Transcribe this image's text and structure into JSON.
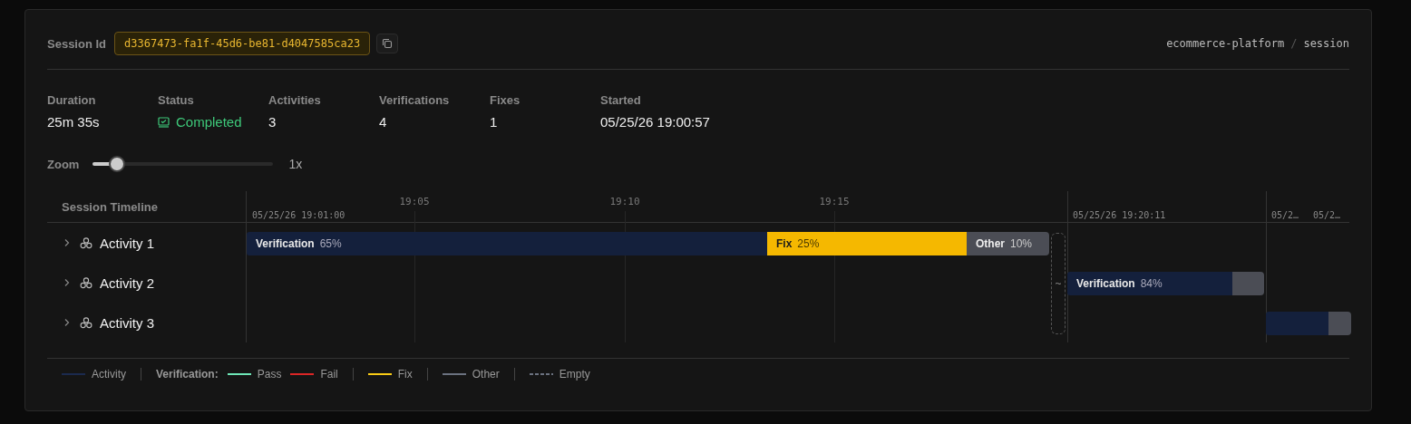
{
  "session": {
    "label": "Session Id",
    "id": "d3367473-fa1f-45d6-be81-d4047585ca23"
  },
  "breadcrumb": {
    "separator": "/",
    "items": [
      "ecommerce-platform",
      "session"
    ]
  },
  "stats": [
    {
      "label": "Duration",
      "value": "25m 35s",
      "kind": "plain"
    },
    {
      "label": "Status",
      "value": "Completed",
      "kind": "status"
    },
    {
      "label": "Activities",
      "value": "3",
      "kind": "plain"
    },
    {
      "label": "Verifications",
      "value": "4",
      "kind": "plain"
    },
    {
      "label": "Fixes",
      "value": "1",
      "kind": "plain"
    },
    {
      "label": "Started",
      "value": "05/25/26 19:00:57",
      "kind": "plain"
    }
  ],
  "zoom": {
    "label": "Zoom",
    "level": 0.135,
    "reading": "1x"
  },
  "timeline": {
    "header": "Session Timeline",
    "ticks": [
      "19:05",
      "19:10",
      "19:15"
    ],
    "sections": [
      "05/25/26 19:01:00",
      "05/25/26 19:20:11",
      "05/2…",
      "05/2…"
    ],
    "gap": {
      "label": "~"
    },
    "activities": [
      {
        "name": "Activity 1",
        "expanded": false,
        "segments": [
          {
            "kind": "verification",
            "label": "Verification",
            "percent": "65%"
          },
          {
            "kind": "fix",
            "label": "Fix",
            "percent": "25%"
          },
          {
            "kind": "other",
            "label": "Other",
            "percent": "10%"
          }
        ]
      },
      {
        "name": "Activity 2",
        "expanded": false,
        "segments": [
          {
            "kind": "verification",
            "label": "Verification",
            "percent": "84%"
          },
          {
            "kind": "other"
          }
        ]
      },
      {
        "name": "Activity 3",
        "expanded": false,
        "segments": [
          {
            "kind": "verification"
          },
          {
            "kind": "other"
          }
        ]
      }
    ]
  },
  "legend": [
    {
      "items": [
        {
          "label": "Activity",
          "color": "#1b2a4e",
          "kind": "line"
        }
      ]
    },
    {
      "title": "Verification:",
      "items": [
        {
          "label": "Pass",
          "color": "#6ee7b7",
          "kind": "line"
        },
        {
          "label": "Fail",
          "color": "#dc2626",
          "kind": "line"
        }
      ]
    },
    {
      "items": [
        {
          "label": "Fix",
          "color": "#facc15",
          "kind": "line"
        }
      ]
    },
    {
      "items": [
        {
          "label": "Other",
          "color": "#6b7280",
          "kind": "line"
        }
      ]
    },
    {
      "items": [
        {
          "label": "Empty",
          "color": "#6b7280",
          "kind": "dashes"
        }
      ]
    }
  ]
}
